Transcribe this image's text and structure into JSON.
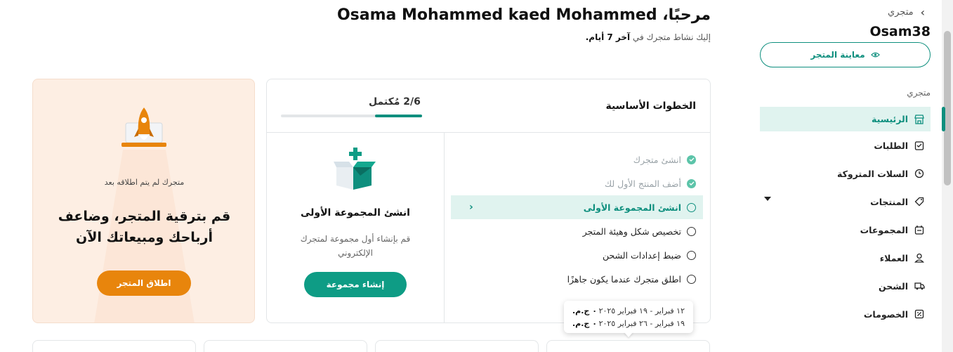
{
  "sidebar": {
    "back_label": "متجري",
    "store_name": "Osam38",
    "preview_label": "معاينة المتجر",
    "section_label": "متجري",
    "items": [
      {
        "label": "الرئيسية",
        "icon": "storefront-icon",
        "active": true
      },
      {
        "label": "الطلبات",
        "icon": "orders-icon"
      },
      {
        "label": "السلات المتروكة",
        "icon": "abandoned-cart-icon"
      },
      {
        "label": "المنتجات",
        "icon": "tag-icon",
        "has_dropdown": true
      },
      {
        "label": "المجموعات",
        "icon": "collections-icon"
      },
      {
        "label": "العملاء",
        "icon": "user-icon"
      },
      {
        "label": "الشحن",
        "icon": "truck-icon"
      },
      {
        "label": "الخصومات",
        "icon": "discount-icon"
      }
    ]
  },
  "header": {
    "greeting": "مرحبًا، Osama Mohammed kaed Mohammed",
    "subtitle_prefix": "إليك نشاط متجرك في",
    "subtitle_bold": "آخر 7 أيام."
  },
  "steps": {
    "title": "الخطوات الأساسية",
    "progress_label": "2/6 مُكتمل",
    "progress_fraction": 0.3333,
    "items": [
      {
        "label": "انشئ متجرك",
        "status": "done"
      },
      {
        "label": "أضف المنتج الأول لك",
        "status": "done"
      },
      {
        "label": "انشئ المجموعة الأولى",
        "status": "current"
      },
      {
        "label": "تخصيص شكل وهيئة المتجر",
        "status": "pending"
      },
      {
        "label": "ضبط إعدادات الشحن",
        "status": "pending"
      },
      {
        "label": "اطلق متجرك عندما يكون جاهزًا",
        "status": "pending"
      }
    ],
    "detail": {
      "title": "انشئ المجموعة الأولى",
      "description": "قم بإنشاء أول مجموعة لمتجرك الإلكتروني",
      "button_label": "إنشاء مجموعة"
    }
  },
  "launch": {
    "small_text": "متجرك لم يتم اطلاقه بعد",
    "big_text": "قم بترقية المتجر، وضاعف أرباحك ومبيعاتك الآن",
    "button_label": "اطلاق المتجر"
  },
  "tooltip": {
    "rows": [
      {
        "range": "١٢ فبراير - ١٩ فبراير ٢٠٢٥",
        "value": "٠ ج.م."
      },
      {
        "range": "١٩ فبراير - ٢٦ فبراير ٢٠٢٥",
        "value": "٠ ج.م."
      }
    ]
  },
  "colors": {
    "accent": "#0e8f7e",
    "launch_button": "#e8850c",
    "launch_bg": "#fdeee3"
  }
}
